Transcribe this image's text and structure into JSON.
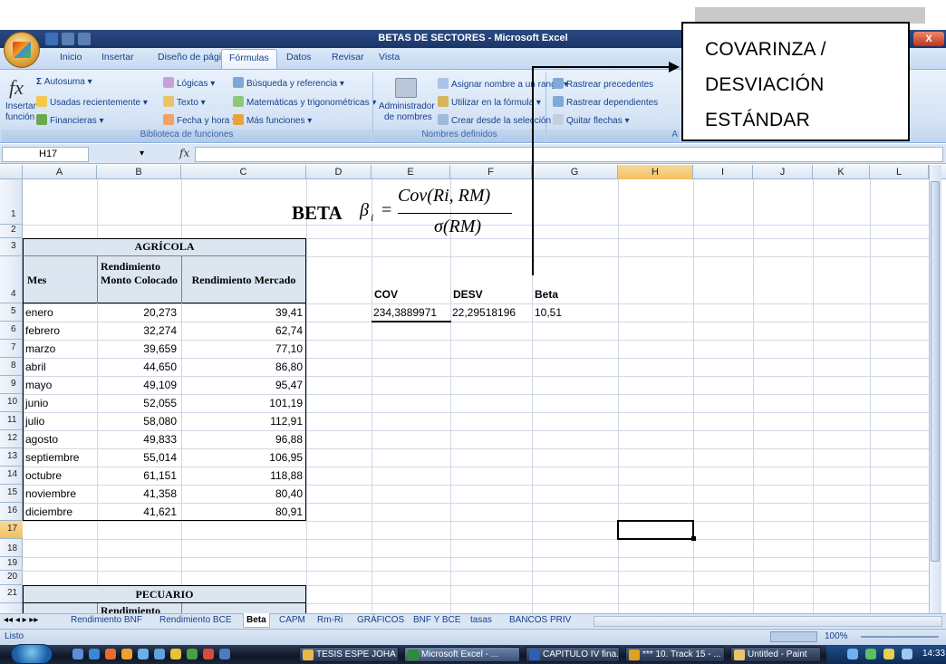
{
  "window": {
    "title": "BETAS DE SECTORES - Microsoft Excel",
    "close_label": "X"
  },
  "ribbon": {
    "tabs": [
      "Inicio",
      "Insertar",
      "Diseño de página",
      "Fórmulas",
      "Datos",
      "Revisar",
      "Vista"
    ],
    "active_tab": "Fórmulas",
    "insert_function_line1": "Insertar",
    "insert_function_line2": "función",
    "library": {
      "autosuma": "Autosuma ▾",
      "recientes": "Usadas recientemente ▾",
      "financieras": "Financieras ▾",
      "logicas": "Lógicas ▾",
      "texto": "Texto ▾",
      "fecha": "Fecha y hora ▾",
      "busqueda": "Búsqueda y referencia ▾",
      "matematicas": "Matemáticas y trigonométricas ▾",
      "mas": "Más funciones ▾",
      "group_label": "Biblioteca de funciones"
    },
    "names": {
      "admin_line1": "Administrador",
      "admin_line2": "de nombres",
      "asignar": "Asignar nombre a un rango ▾",
      "utilizar": "Utilizar en la fórmula ▾",
      "crear": "Crear desde la selección",
      "group_label": "Nombres definidos"
    },
    "audit": {
      "precedentes": "Rastrear precedentes",
      "dependientes": "Rastrear dependientes",
      "quitar": "Quitar flechas ▾",
      "group_label": "A"
    }
  },
  "formula_bar": {
    "name_box": "H17",
    "fx": "fx",
    "value": ""
  },
  "columns": [
    "A",
    "B",
    "C",
    "D",
    "E",
    "F",
    "G",
    "H",
    "I",
    "J",
    "K",
    "L"
  ],
  "selected_column": "H",
  "rows": [
    "1",
    "2",
    "3",
    "4",
    "5",
    "6",
    "7",
    "8",
    "9",
    "10",
    "11",
    "12",
    "13",
    "14",
    "15",
    "16",
    "17",
    "18",
    "19",
    "20",
    "21"
  ],
  "selected_row": "17",
  "beta_heading": "BETA",
  "beta_formula": {
    "lhs": "β",
    "lhs_sub": "i",
    "equals": "=",
    "numerator": "Cov(Ri, RM)",
    "denominator": "σ(RM)"
  },
  "agricola": {
    "title": "AGRÍCOLA",
    "headers": [
      "Mes",
      "Rendimiento Monto Colocado",
      "Rendimiento Mercado"
    ],
    "rows": [
      [
        "enero",
        "20,273",
        "39,41"
      ],
      [
        "febrero",
        "32,274",
        "62,74"
      ],
      [
        "marzo",
        "39,659",
        "77,10"
      ],
      [
        "abril",
        "44,650",
        "86,80"
      ],
      [
        "mayo",
        "49,109",
        "95,47"
      ],
      [
        "junio",
        "52,055",
        "101,19"
      ],
      [
        "julio",
        "58,080",
        "112,91"
      ],
      [
        "agosto",
        "49,833",
        "96,88"
      ],
      [
        "septiembre",
        "55,014",
        "106,95"
      ],
      [
        "octubre",
        "61,151",
        "118,88"
      ],
      [
        "noviembre",
        "41,358",
        "80,40"
      ],
      [
        "diciembre",
        "41,621",
        "80,91"
      ]
    ]
  },
  "pecuario": {
    "title": "PECUARIO",
    "partial_header": "Rendimiento"
  },
  "results": {
    "headers": [
      "COV",
      "DESV",
      "Beta"
    ],
    "values": [
      "234,3889971",
      "22,29518196",
      "10,51"
    ]
  },
  "callout": {
    "line1": "COVARINZA /",
    "line2": "DESVIACIÓN",
    "line3": "ESTÁNDAR"
  },
  "sheet_tabs": [
    "Rendimiento BNF",
    "Rendimiento BCE",
    "Beta",
    "CAPM",
    "Rm-Ri",
    "GRÁFICOS",
    "BNF Y BCE",
    "tasas",
    "BANCOS PRIV"
  ],
  "active_sheet": "Beta",
  "status": {
    "mode": "Listo",
    "zoom": "100%"
  },
  "taskbar": {
    "items": [
      "TESIS ESPE JOHA",
      "Microsoft Excel - ...",
      "CAPITULO IV fina...",
      "*** 10. Track 15 - ...",
      "Untitled - Paint"
    ],
    "active_item": "Microsoft Excel - ...",
    "clock": "14:33"
  }
}
